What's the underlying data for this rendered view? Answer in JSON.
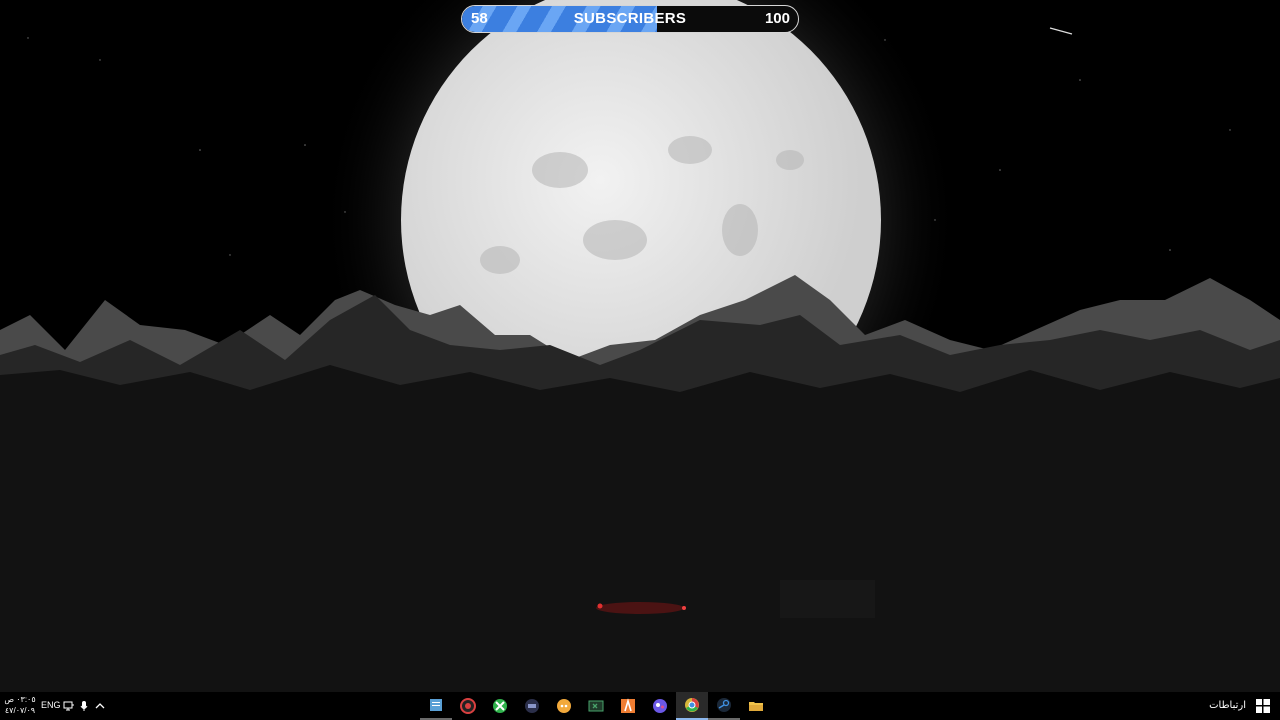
{
  "subscriber_widget": {
    "current": "58",
    "label": "SUBSCRIBERS",
    "goal": "100",
    "progress_fraction": 0.58,
    "fill_color": "#3c7fe0"
  },
  "taskbar": {
    "clock_time": "٠٣:٠٥ ص",
    "clock_date": "٤٧/٠٧/٠٩",
    "language": "ENG",
    "links_label": "ارتباطات",
    "system_tray": [
      "chevron-up-icon",
      "microphone-icon",
      "network-icon"
    ],
    "apps": [
      {
        "name": "notepad-icon",
        "color": "#5aa0d6"
      },
      {
        "name": "capture-app-icon",
        "color": "#d94040"
      },
      {
        "name": "xbox-icon",
        "color": "#2fb24b"
      },
      {
        "name": "dock-app-icon",
        "color": "#8a96c9"
      },
      {
        "name": "discord-icon",
        "color": "#f2a93b"
      },
      {
        "name": "terminal-icon",
        "color": "#49a36b"
      },
      {
        "name": "adobe-icon",
        "color": "#ef7d32"
      },
      {
        "name": "paint-app-icon",
        "color": "#6b58e6"
      },
      {
        "name": "chrome-icon",
        "color": "#d6b63a"
      },
      {
        "name": "steam-icon",
        "color": "#3f8fe0"
      },
      {
        "name": "file-explorer-icon",
        "color": "#f0c24a"
      }
    ]
  }
}
